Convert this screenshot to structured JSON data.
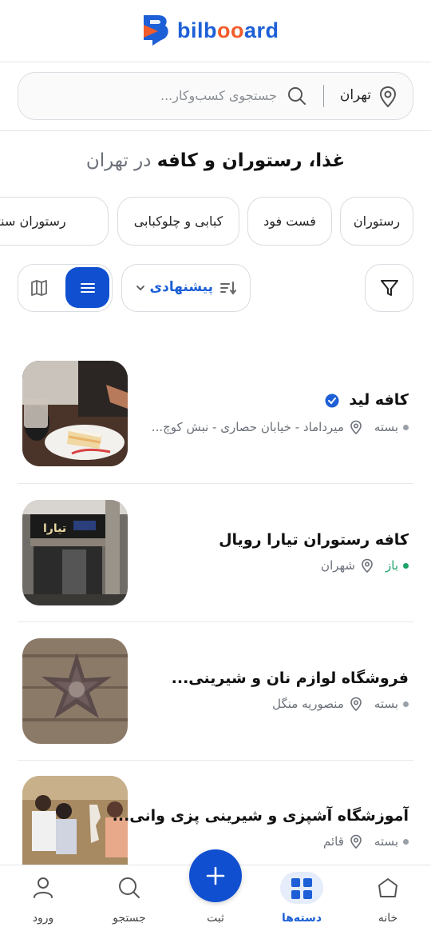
{
  "header": {
    "logo_text_a": "bilb",
    "logo_text_oo": "oo",
    "logo_text_b": "ard",
    "logo_icon": "bilboard-logo-icon"
  },
  "search": {
    "location": "تهران",
    "placeholder": "جستجوی کسب‌وکار...",
    "location_icon": "map-pin-icon",
    "search_icon": "search-icon"
  },
  "title": {
    "bold": "غذا، رستوران و کافه",
    "light": "در تهران"
  },
  "categories": [
    "رستوران",
    "فست فود",
    "کبابی و چلوکبابی",
    "رستوران سنتی"
  ],
  "toolbar": {
    "sort_label": "پیشنهادی",
    "filter_icon": "filter-icon",
    "sort_icon": "sort-icon",
    "view_list_icon": "list-icon",
    "view_map_icon": "map-icon",
    "active_view": "list"
  },
  "listings": [
    {
      "name": "کافه لید",
      "verified": true,
      "status": "بسته",
      "address": "میرداماد - خیابان حصاری - نبش کوچ..."
    },
    {
      "name": "کافه رستوران تیارا رویال",
      "verified": false,
      "status": "باز",
      "address": "شهران"
    },
    {
      "name": "فروشگاه لوازم نان و شیرینی...",
      "verified": false,
      "status": "بسته",
      "address": "منصوریه منگل"
    },
    {
      "name": "آموزشگاه آشپزی و شیرینی پزی وانی...",
      "verified": false,
      "status": "بسته",
      "address": "قائم"
    }
  ],
  "bottom_nav": [
    {
      "label": "خانه",
      "icon": "home-icon",
      "active": false
    },
    {
      "label": "دسته‌ها",
      "icon": "categories-icon",
      "active": true
    },
    {
      "label": "ثبت",
      "icon": "plus-icon",
      "active": false
    },
    {
      "label": "جستجو",
      "icon": "search-icon",
      "active": false
    },
    {
      "label": "ورود",
      "icon": "user-icon",
      "active": false
    }
  ],
  "colors": {
    "brand_blue": "#1d5fd6",
    "accent_orange": "#f25c2a",
    "open_green": "#1fa36b",
    "closed_gray": "#9aa0a8"
  }
}
